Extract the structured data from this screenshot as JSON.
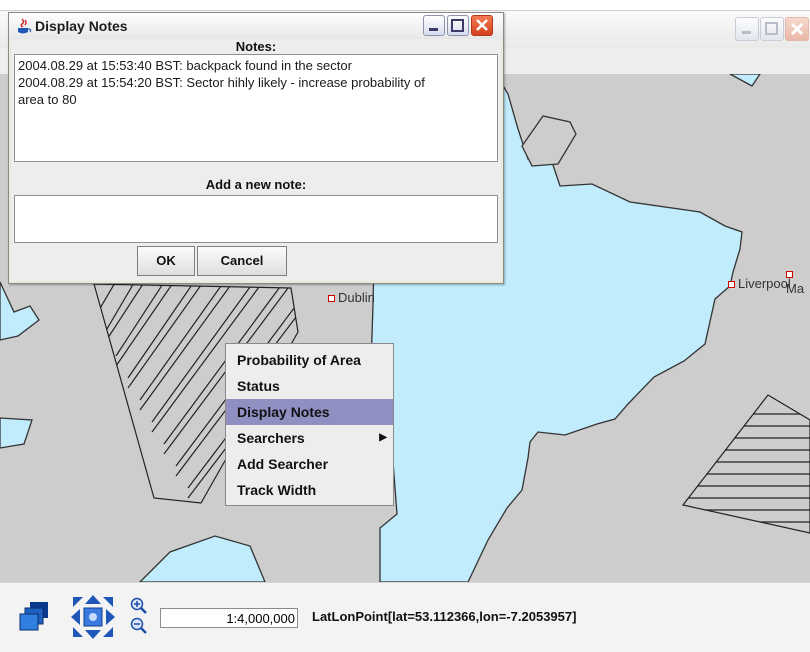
{
  "main_window": {
    "title": ""
  },
  "map": {
    "colors": {
      "land": "#cdcdcd",
      "sea": "#c0ecfc",
      "hatch": "#222222"
    },
    "cities": [
      {
        "name": "Dublin"
      },
      {
        "name": "Liverpool"
      },
      {
        "name": "Ma"
      }
    ]
  },
  "dialog": {
    "title": "Display Notes",
    "notes_label": "Notes:",
    "notes_lines": [
      "2004.08.29 at 15:53:40 BST: backpack found in the sector",
      "2004.08.29 at 15:54:20 BST: Sector hihly likely - increase probability of",
      "area to 80"
    ],
    "add_note_label": "Add a new note:",
    "new_note_value": "",
    "ok_label": "OK",
    "cancel_label": "Cancel"
  },
  "context_menu": {
    "items": [
      {
        "label": "Probability of Area",
        "submenu": false,
        "selected": false
      },
      {
        "label": "Status",
        "submenu": false,
        "selected": false
      },
      {
        "label": "Display Notes",
        "submenu": false,
        "selected": true
      },
      {
        "label": "Searchers",
        "submenu": true,
        "selected": false
      },
      {
        "label": "Add Searcher",
        "submenu": false,
        "selected": false
      },
      {
        "label": "Track Width",
        "submenu": false,
        "selected": false
      }
    ],
    "submenu_arrow": "▶"
  },
  "statusbar": {
    "icons": [
      "layers-icon",
      "pan-navigation-icon",
      "zoom-in-icon",
      "zoom-out-icon"
    ],
    "scale": "1:4,000,000",
    "coordinates": "LatLonPoint[lat=53.112366,lon=-7.2053957]"
  }
}
